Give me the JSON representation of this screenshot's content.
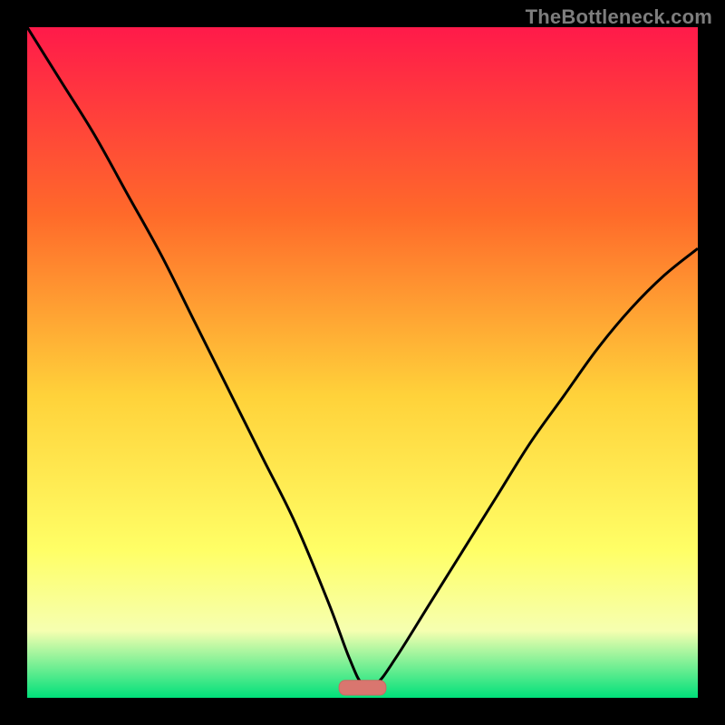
{
  "watermark": "TheBottleneck.com",
  "colors": {
    "frame": "#000000",
    "gradient_top": "#ff1a4a",
    "gradient_mid1": "#ff6a2a",
    "gradient_mid2": "#ffd23a",
    "gradient_mid3": "#ffff66",
    "gradient_near_bottom": "#f6ffb0",
    "gradient_bottom": "#00e07a",
    "curve": "#000000",
    "marker_fill": "#d9766f",
    "marker_stroke": "#c96a63"
  },
  "chart_data": {
    "type": "line",
    "title": "",
    "xlabel": "",
    "ylabel": "",
    "xlim": [
      0,
      100
    ],
    "ylim": [
      0,
      100
    ],
    "grid": false,
    "legend": false,
    "annotations": [],
    "series": [
      {
        "name": "curve",
        "x": [
          0,
          5,
          10,
          15,
          20,
          25,
          30,
          35,
          40,
          45,
          48,
          50,
          52,
          55,
          60,
          65,
          70,
          75,
          80,
          85,
          90,
          95,
          100
        ],
        "y": [
          100,
          92,
          84,
          75,
          66,
          56,
          46,
          36,
          26,
          14,
          6,
          2,
          2,
          6,
          14,
          22,
          30,
          38,
          45,
          52,
          58,
          63,
          67
        ]
      }
    ],
    "marker": {
      "x": 50,
      "y": 1.5,
      "width": 7,
      "height": 2.2,
      "shape": "rounded-rect"
    },
    "gradient_stops": [
      {
        "offset": 0,
        "color": "#ff1a4a"
      },
      {
        "offset": 28,
        "color": "#ff6a2a"
      },
      {
        "offset": 55,
        "color": "#ffd23a"
      },
      {
        "offset": 78,
        "color": "#ffff66"
      },
      {
        "offset": 90,
        "color": "#f6ffb0"
      },
      {
        "offset": 100,
        "color": "#00e07a"
      }
    ]
  }
}
